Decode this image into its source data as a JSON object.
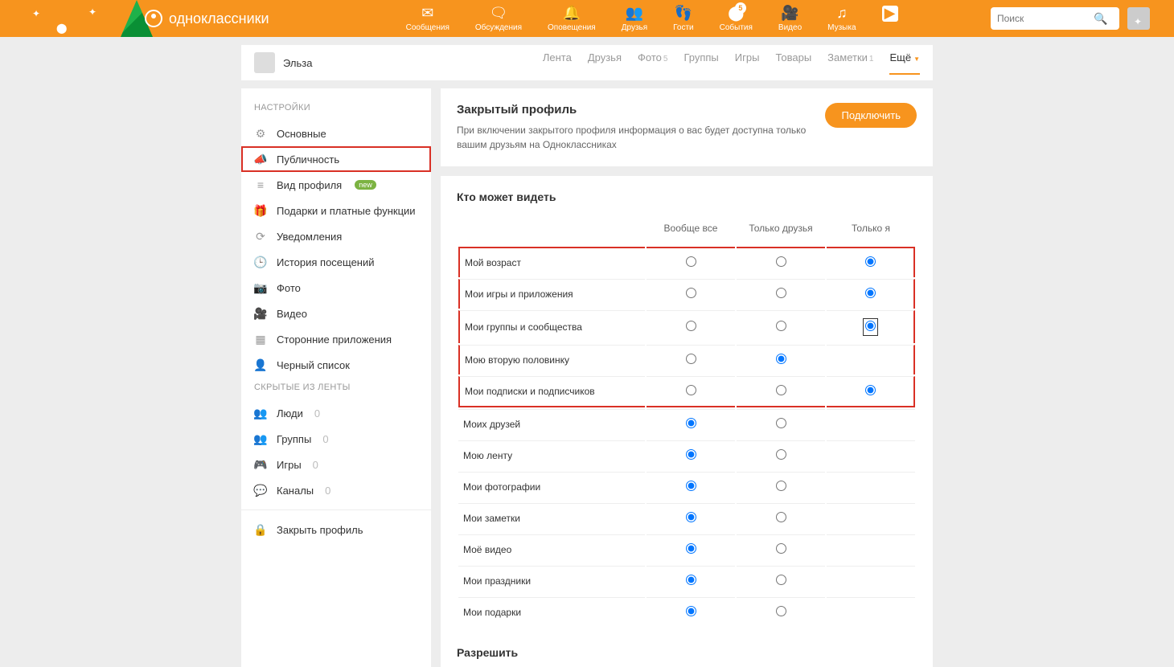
{
  "brand": "одноклассники",
  "header_nav": [
    {
      "label": "Сообщения",
      "icon": "✉"
    },
    {
      "label": "Обсуждения",
      "icon": "🗨"
    },
    {
      "label": "Оповещения",
      "icon": "🔔"
    },
    {
      "label": "Друзья",
      "icon": "👥"
    },
    {
      "label": "Гости",
      "icon": "👣"
    },
    {
      "label": "События",
      "icon": "⬤",
      "badge": "5"
    },
    {
      "label": "Видео",
      "icon": "🎥"
    },
    {
      "label": "Музыка",
      "icon": "♫"
    }
  ],
  "search_placeholder": "Поиск",
  "profile_name": "Эльза",
  "profile_tabs": [
    {
      "label": "Лента"
    },
    {
      "label": "Друзья"
    },
    {
      "label": "Фото",
      "count": "5"
    },
    {
      "label": "Группы"
    },
    {
      "label": "Игры"
    },
    {
      "label": "Товары"
    },
    {
      "label": "Заметки",
      "count": "1"
    },
    {
      "label": "Ещё",
      "active": true,
      "chev": true
    }
  ],
  "sidebar": {
    "title1": "НАСТРОЙКИ",
    "items1": [
      {
        "label": "Основные",
        "icon": "⚙"
      },
      {
        "label": "Публичность",
        "icon": "📣",
        "active": true
      },
      {
        "label": "Вид профиля",
        "icon": "≡",
        "new": "new"
      },
      {
        "label": "Подарки и платные функции",
        "icon": "🎁"
      },
      {
        "label": "Уведомления",
        "icon": "⟳"
      },
      {
        "label": "История посещений",
        "icon": "🕒"
      },
      {
        "label": "Фото",
        "icon": "📷"
      },
      {
        "label": "Видео",
        "icon": "🎥"
      },
      {
        "label": "Сторонние приложения",
        "icon": "▦"
      },
      {
        "label": "Черный список",
        "icon": "👤"
      }
    ],
    "title2": "СКРЫТЫЕ ИЗ ЛЕНТЫ",
    "items2": [
      {
        "label": "Люди",
        "icon": "👥",
        "count": "0"
      },
      {
        "label": "Группы",
        "icon": "👥",
        "count": "0"
      },
      {
        "label": "Игры",
        "icon": "🎮",
        "count": "0"
      },
      {
        "label": "Каналы",
        "icon": "💬",
        "count": "0"
      }
    ],
    "lock": {
      "label": "Закрыть профиль",
      "icon": "🔒"
    }
  },
  "closed": {
    "title": "Закрытый профиль",
    "desc": "При включении закрытого профиля информация о вас будет доступна только вашим друзьям на Одноклассниках",
    "btn": "Подключить"
  },
  "who_title": "Кто может видеть",
  "columns": [
    "Вообще все",
    "Только друзья",
    "Только я"
  ],
  "rows": [
    {
      "label": "Мой возраст",
      "sel": 2,
      "hl": true,
      "cols": 3
    },
    {
      "label": "Мои игры и приложения",
      "sel": 2,
      "hl": true,
      "cols": 3
    },
    {
      "label": "Мои группы и сообщества",
      "sel": 2,
      "hl": true,
      "cols": 3,
      "boxed": true
    },
    {
      "label": "Мою вторую половинку",
      "sel": 1,
      "hl": true,
      "cols": 2
    },
    {
      "label": "Мои подписки и подписчиков",
      "sel": 2,
      "hl": true,
      "cols": 3
    },
    {
      "label": "Моих друзей",
      "sel": 0,
      "cols": 2
    },
    {
      "label": "Мою ленту",
      "sel": 0,
      "cols": 2
    },
    {
      "label": "Мои фотографии",
      "sel": 0,
      "cols": 2
    },
    {
      "label": "Мои заметки",
      "sel": 0,
      "cols": 2
    },
    {
      "label": "Моё видео",
      "sel": 0,
      "cols": 2
    },
    {
      "label": "Мои праздники",
      "sel": 0,
      "cols": 2
    },
    {
      "label": "Мои подарки",
      "sel": 0,
      "cols": 2
    }
  ],
  "allow_title": "Разрешить"
}
